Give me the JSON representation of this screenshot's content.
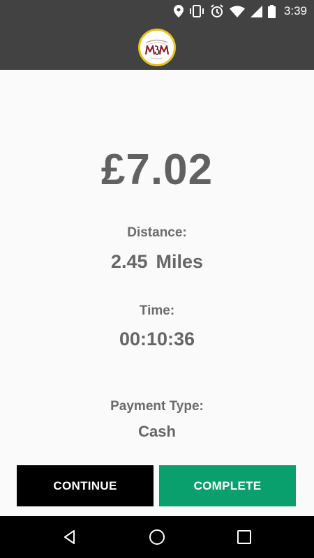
{
  "status_bar": {
    "time": "3:39",
    "icons": [
      "location-icon",
      "vibrate-icon",
      "alarm-icon",
      "wifi-icon",
      "signal-icon",
      "battery-icon"
    ]
  },
  "app_bar": {
    "logo": "mm-logo"
  },
  "trip": {
    "fare": "£7.02",
    "distance_label": "Distance:",
    "distance_value": "2.45",
    "distance_unit": "Miles",
    "time_label": "Time:",
    "time_value": "00:10:36",
    "payment_label": "Payment Type:",
    "payment_value": "Cash"
  },
  "actions": {
    "continue_label": "CONTINUE",
    "complete_label": "COMPLETE"
  },
  "nav_bar": {
    "icons": [
      "back-icon",
      "home-icon",
      "recents-icon"
    ]
  },
  "colors": {
    "bar": "#424242",
    "complete": "#0aa06e",
    "continue": "#000000",
    "text": "#616161"
  }
}
